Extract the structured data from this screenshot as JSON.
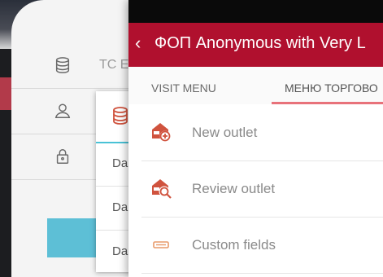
{
  "login": {
    "rows": [
      {
        "icon": "database-icon",
        "text": "TC E"
      },
      {
        "icon": "user-icon",
        "text": ""
      },
      {
        "icon": "lock-icon",
        "text": ""
      }
    ]
  },
  "dropdown": {
    "header_icon": "database-icon",
    "items": [
      "Da",
      "Da",
      "Da"
    ]
  },
  "app": {
    "title": "ФОП Anonymous with Very L",
    "back_icon": "chevron-left-icon",
    "tabs": [
      {
        "label": "VISIT MENU",
        "active": false
      },
      {
        "label": "МЕНЮ ТОРГОВО",
        "active": true
      }
    ],
    "menu": [
      {
        "label": "New outlet",
        "icon": "store-add-icon"
      },
      {
        "label": "Review outlet",
        "icon": "store-search-icon"
      },
      {
        "label": "Custom fields",
        "icon": "keyboard-icon"
      }
    ],
    "colors": {
      "primary": "#b0102e",
      "accent": "#e8727a",
      "icon": "#d0533e",
      "login_button": "#5dbfd6"
    }
  }
}
